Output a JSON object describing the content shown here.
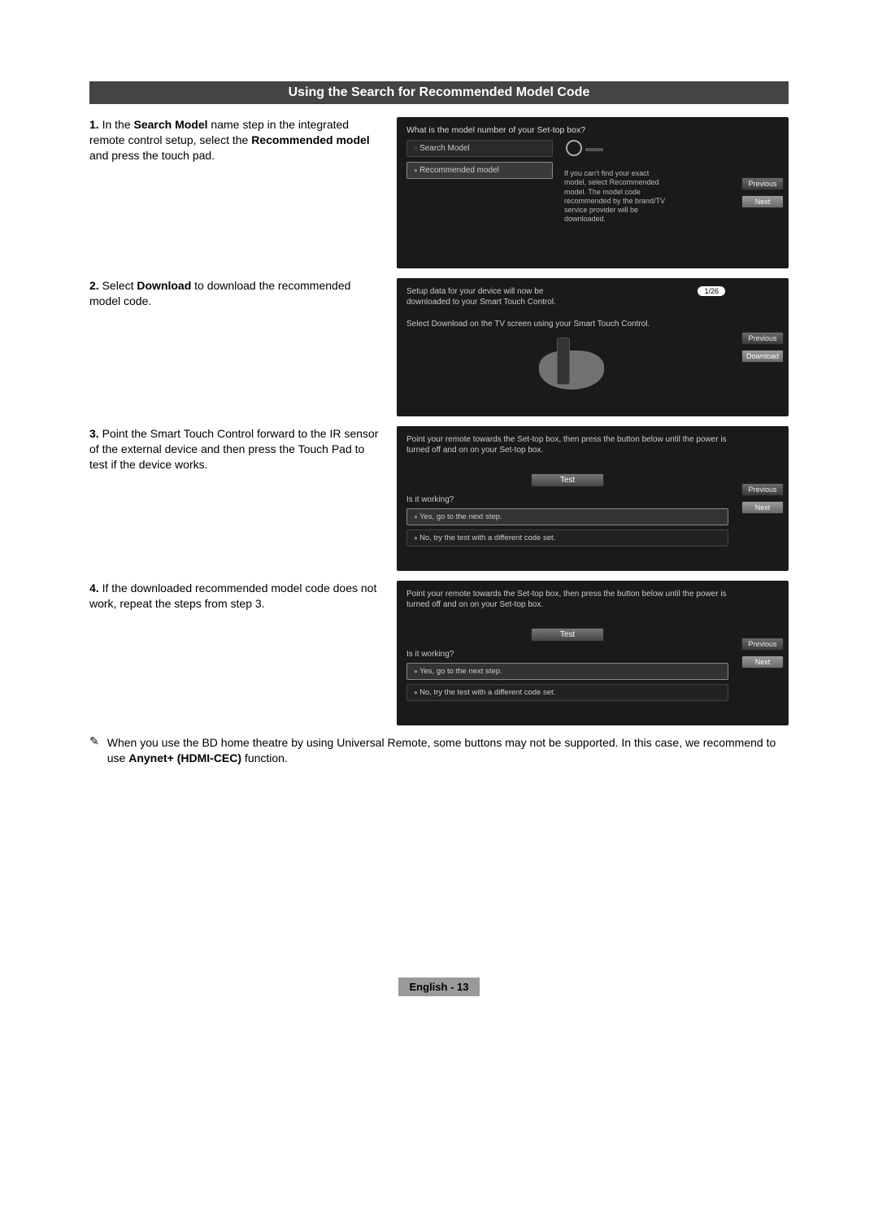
{
  "header": "Using the Search for Recommended Model Code",
  "steps": {
    "s1": {
      "num": "1.",
      "text_a": "In the ",
      "bold_a": "Search Model",
      "text_b": " name step in the integrated remote control setup, select the ",
      "bold_b": "Recommended model",
      "text_c": " and press the touch pad."
    },
    "s2": {
      "num": "2.",
      "text_a": "Select ",
      "bold_a": "Download",
      "text_b": " to download the recommended model code."
    },
    "s3": {
      "num": "3.",
      "text": "Point the Smart Touch Control forward to the IR sensor of the external device and then press the Touch Pad to test if the device works."
    },
    "s4": {
      "num": "4.",
      "text": "If the downloaded recommended model code does not work, repeat the steps from step 3."
    }
  },
  "screen1": {
    "question": "What is the model number of your Set-top box?",
    "opt1": "Search Model",
    "opt2": "Recommended model",
    "helper": "If you can't find your exact model, select Recommended model. The model code recommended by the brand/TV service provider will be downloaded.",
    "btn_prev": "Previous",
    "btn_next": "Next"
  },
  "screen2": {
    "line1": "Setup data for your device will now be downloaded to your Smart Touch Control.",
    "line2": "Select Download on the TV screen using your Smart Touch Control.",
    "counter": "1/26",
    "btn_prev": "Previous",
    "btn_dl": "Download"
  },
  "screen3": {
    "instr": "Point your remote towards the Set-top box, then press the button below until the power is turned off and on on your Set-top box.",
    "test": "Test",
    "isit": "Is it working?",
    "yes": "Yes, go to the next step.",
    "no": "No, try the test with a different code set.",
    "btn_prev": "Previous",
    "btn_next": "Next"
  },
  "screen4": {
    "instr": "Point your remote towards the Set-top box, then press the button below until the power is turned off and on on your Set-top box.",
    "test": "Test",
    "isit": "Is it working?",
    "yes": "Yes, go to the next step.",
    "no": "No, try the test with a different code set.",
    "btn_prev": "Previous",
    "btn_next": "Next"
  },
  "note": {
    "symbol": "✎",
    "text_a": "When you use the BD home theatre by using Universal Remote, some buttons may not be supported. In this case, we recommend to use ",
    "bold": "Anynet+ (HDMI-CEC)",
    "text_b": " function."
  },
  "footer": "English - 13"
}
